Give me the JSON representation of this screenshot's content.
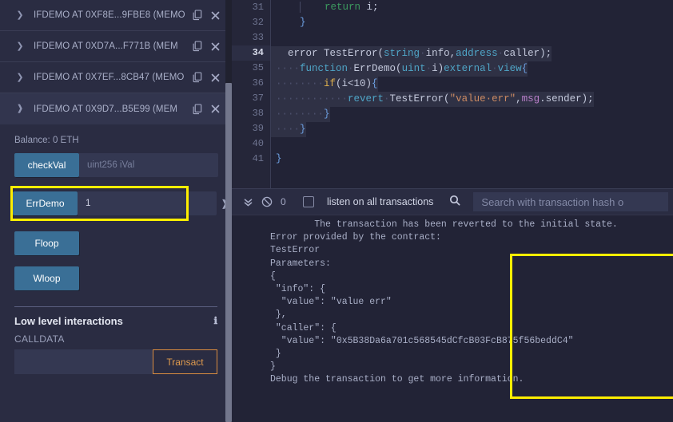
{
  "left_panel": {
    "contracts": [
      {
        "label": "IFDEMO AT 0XF8E...9FBE8 (MEMO",
        "expanded": false,
        "copy_icon": "copy-icon",
        "close_icon": "close-icon"
      },
      {
        "label": "IFDEMO AT 0XD7A...F771B (MEM",
        "expanded": false,
        "copy_icon": "copy-icon",
        "close_icon": "close-icon"
      },
      {
        "label": "IFDEMO AT 0X7EF...8CB47 (MEMO",
        "expanded": false,
        "copy_icon": "copy-icon",
        "close_icon": "close-icon"
      },
      {
        "label": "IFDEMO AT 0X9D7...B5E99 (MEM",
        "expanded": true,
        "copy_icon": "copy-icon",
        "close_icon": "close-icon"
      }
    ],
    "balance": "Balance: 0 ETH",
    "functions": [
      {
        "name": "checkVal",
        "input_value": "",
        "input_placeholder": "uint256 iVal",
        "caret": "chevron-down-icon",
        "highlighted": false
      },
      {
        "name": "ErrDemo",
        "input_value": "1",
        "input_placeholder": "",
        "caret": "chevron-down-icon",
        "highlighted": true
      },
      {
        "name": "Floop",
        "input_value": null,
        "input_placeholder": null,
        "caret": null,
        "highlighted": false
      },
      {
        "name": "Wloop",
        "input_value": null,
        "input_placeholder": null,
        "caret": null,
        "highlighted": false
      }
    ],
    "low_level": {
      "title": "Low level interactions",
      "info_icon": "info-icon",
      "calldata_label": "CALLDATA",
      "calldata_value": "",
      "calldata_placeholder": "",
      "transact_label": "Transact"
    }
  },
  "editor": {
    "lines": [
      {
        "num": "31",
        "active": false
      },
      {
        "num": "32",
        "active": false
      },
      {
        "num": "33",
        "active": false
      },
      {
        "num": "34",
        "active": true
      },
      {
        "num": "35",
        "active": false
      },
      {
        "num": "36",
        "active": false
      },
      {
        "num": "37",
        "active": false
      },
      {
        "num": "38",
        "active": false
      },
      {
        "num": "39",
        "active": false
      },
      {
        "num": "40",
        "active": false
      },
      {
        "num": "41",
        "active": false
      }
    ],
    "code": [
      "        return i;",
      "    }",
      "",
      "    error TestError(string info,address caller);",
      "    function ErrDemo(uint i)external view{",
      "        if(i<10){",
      "            revert TestError(\"value err\",msg.sender);",
      "        }",
      "    }",
      "",
      "}"
    ]
  },
  "terminal": {
    "toolbar": {
      "collapse_icon": "double-chevron-down-icon",
      "clear_icon": "ban-icon",
      "count": "0",
      "listen_label": "listen on all transactions",
      "listen_checked": false,
      "search_icon": "search-icon",
      "search_value": "",
      "search_placeholder": "Search with transaction hash o"
    },
    "output": [
      {
        "text": "        The transaction has been reverted to the initial state.",
        "boxed": false
      },
      {
        "text": "Error provided by the contract:",
        "boxed": false
      },
      {
        "text": "TestError",
        "boxed": false
      },
      {
        "text": "Parameters:",
        "boxed": true
      },
      {
        "text": "{",
        "boxed": true
      },
      {
        "text": " \"info\": {",
        "boxed": true
      },
      {
        "text": "  \"value\": \"value err\"",
        "boxed": true
      },
      {
        "text": " },",
        "boxed": true
      },
      {
        "text": " \"caller\": {",
        "boxed": true
      },
      {
        "text": "  \"value\": \"0x5B38Da6a701c568545dCfcB03FcB875f56beddC4\"",
        "boxed": true
      },
      {
        "text": " }",
        "boxed": true
      },
      {
        "text": "}",
        "boxed": true
      },
      {
        "text": "Debug the transaction to get more information.",
        "boxed": true
      }
    ]
  },
  "colors": {
    "highlight": "#ffee00",
    "accent_button": "#3a6f96",
    "transact_border": "#d98c3f",
    "panel_bg": "#2a2c42",
    "editor_bg": "#222336"
  }
}
